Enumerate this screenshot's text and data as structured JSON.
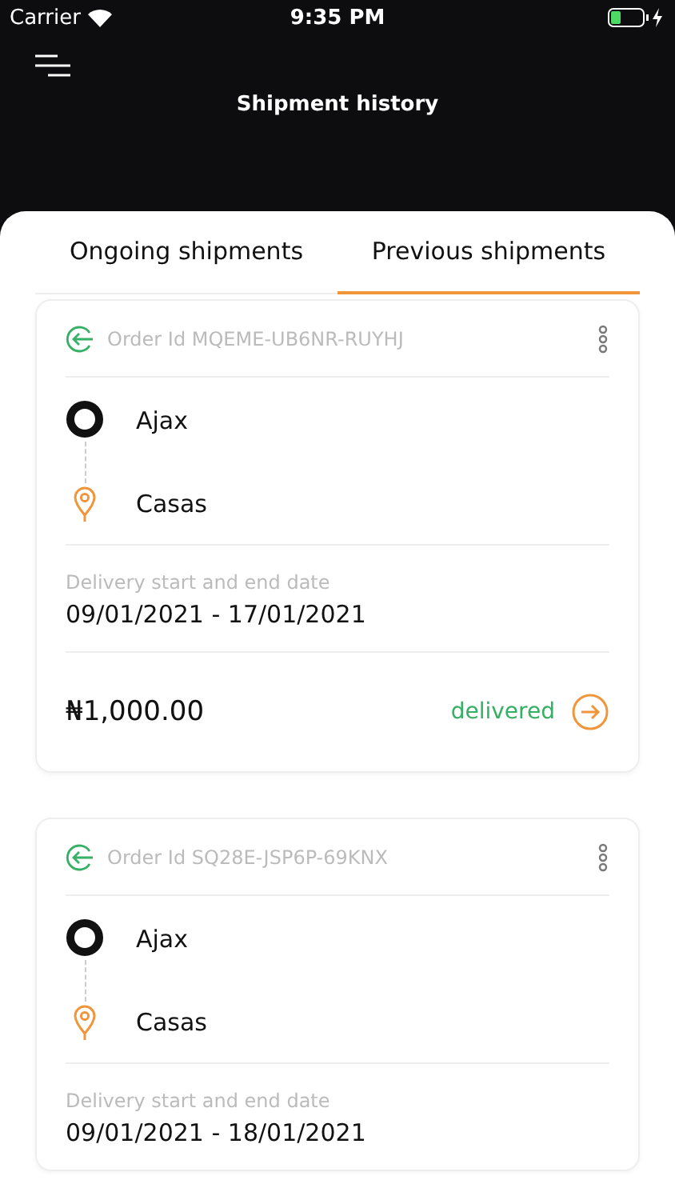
{
  "status_bar": {
    "carrier": "Carrier",
    "time": "9:35 PM"
  },
  "header": {
    "title": "Shipment history"
  },
  "tabs": [
    {
      "label": "Ongoing shipments",
      "selected": false
    },
    {
      "label": "Previous shipments",
      "selected": true
    }
  ],
  "shipments": [
    {
      "order_id": "Order Id MQEME-UB6NR-RUYHJ",
      "origin": "Ajax",
      "destination": "Casas",
      "date_label": "Delivery start and end date",
      "dates": "09/01/2021 - 17/01/2021",
      "price": "₦1,000.00",
      "status": "delivered"
    },
    {
      "order_id": "Order Id SQ28E-JSP6P-69KNX",
      "origin": "Ajax",
      "destination": "Casas",
      "date_label": "Delivery start and end date",
      "dates": "09/01/2021 - 18/01/2021"
    }
  ]
}
